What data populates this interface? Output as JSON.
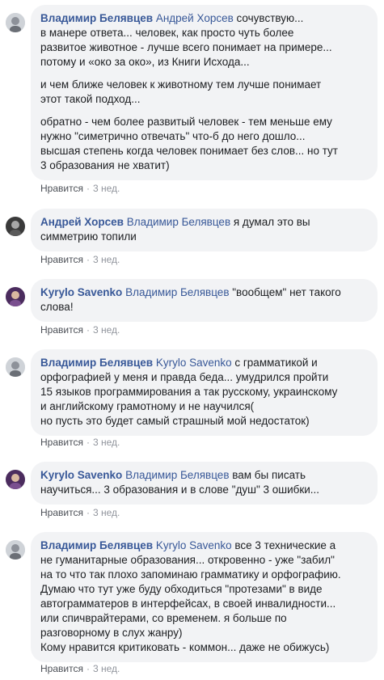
{
  "comments": [
    {
      "author": "Владимир Белявцев",
      "mention": "Андрей Хорсев",
      "first_line_rest": " сочувствую...",
      "paragraphs": [
        [
          "в манере ответа... человек, как просто чуть более",
          "развитое животное - лучше всего понимает на примере...",
          "потому и «око за око», из Книги Исхода..."
        ],
        [
          "и чем ближе человек к животному тем лучше понимает",
          "этот такой подход..."
        ],
        [
          "обратно - чем более развитый человек - тем меньше ему",
          "нужно \"симетрично отвечать\" что-б до него дошло...",
          "высшая степень когда человек понимает без слов... но тут",
          "3 образования не хватит)"
        ]
      ],
      "like": "Нравится",
      "time": "3 нед."
    },
    {
      "author": "Андрей Хорсев",
      "mention": "Владимир Белявцев",
      "first_line_rest": " я думал это вы",
      "lines": [
        "симметрию топили"
      ],
      "like": "Нравится",
      "time": "3 нед."
    },
    {
      "author": "Kyrylo Savenko",
      "mention": "Владимир Белявцев",
      "first_line_rest": " \"вообщем\" нет такого",
      "lines": [
        "слова!"
      ],
      "like": "Нравится",
      "time": "3 нед."
    },
    {
      "author": "Владимир Белявцев",
      "mention": "Kyrylo Savenko",
      "first_line_rest": " с грамматикой и",
      "lines": [
        "орфографией у меня и правда беда... умудрился пройти",
        "15 языков программирования а так русскому, украинскому",
        "и английскому грамотному и не научился(",
        "но пусть это будет самый страшный мой недостаток)"
      ],
      "like": "Нравится",
      "time": "3 нед."
    },
    {
      "author": "Kyrylo Savenko",
      "mention": "Владимир Белявцев",
      "first_line_rest": " вам бы писать",
      "lines": [
        "научиться... 3 образования и в слове \"душ\" 3 ошибки..."
      ],
      "like": "Нравится",
      "time": "3 нед."
    },
    {
      "author": "Владимир Белявцев",
      "mention": "Kyrylo Savenko",
      "first_line_rest": " все 3 технические а",
      "lines": [
        "не гуманитарные образования... откровенно - уже \"забил\"",
        "на то что так плохо запоминаю грамматику и орфографию.",
        "Думаю что тут уже буду обходиться \"протезами\" в виде",
        "автограмматеров в интерфейсах, в своей инвалидности...",
        "или спичврайтерами, со временем. я больше по",
        "разговорному в слух жанру)",
        "Кому нравится критиковать - коммон... даже не обижусь)"
      ],
      "like": "Нравится",
      "time": "3 нед."
    }
  ],
  "separator": "·",
  "colors": {
    "link": "#385898",
    "bubble": "#f2f3f5",
    "meta": "#90949c"
  }
}
